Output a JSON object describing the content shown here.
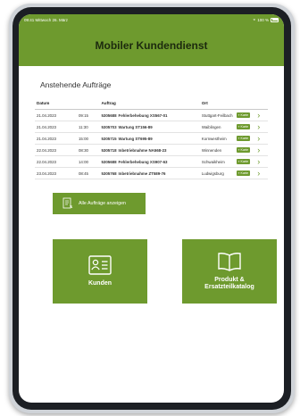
{
  "status_bar": {
    "time_date": "09:41  Mittwoch 26. März",
    "battery": "100 %"
  },
  "header": {
    "title": "Mobiler Kundendienst"
  },
  "orders": {
    "title": "Anstehende Aufträge",
    "columns": {
      "date": "Datum",
      "order": "Auftrag",
      "location": "Ort"
    },
    "map_label": "Karte",
    "rows": [
      {
        "date": "21.04.2023",
        "time": "09:15",
        "number": "5305688",
        "desc": "Fehlerbehebung XS567-01",
        "location": "Stuttgart-Feilbach"
      },
      {
        "date": "21.04.2023",
        "time": "11:30",
        "number": "5305703",
        "desc": "Wartung ST156-89",
        "location": "Waiblingen"
      },
      {
        "date": "21.04.2023",
        "time": "15:00",
        "number": "5305715",
        "desc": "Wartung ST695-89",
        "location": "Kornwestheim"
      },
      {
        "date": "22.04.2023",
        "time": "08:30",
        "number": "5305718",
        "desc": "Inbetriebnahme NA568-23",
        "location": "Winnenden"
      },
      {
        "date": "22.04.2023",
        "time": "14:00",
        "number": "5305688",
        "desc": "Fehlerbehebung XS907-63",
        "location": "Schwaikheim"
      },
      {
        "date": "23.04.2023",
        "time": "08:45",
        "number": "5305768",
        "desc": "Inbetriebnahme ZT589-76",
        "location": "Ludwigsburg"
      }
    ],
    "all_button": "Alle Aufträge anzeigen"
  },
  "tiles": {
    "customers": {
      "label": "Kunden"
    },
    "catalog": {
      "label": "Produkt &\nErsatzteilkatalog"
    }
  },
  "colors": {
    "accent": "#6e9a2e",
    "header_text": "#1c2a0e"
  }
}
